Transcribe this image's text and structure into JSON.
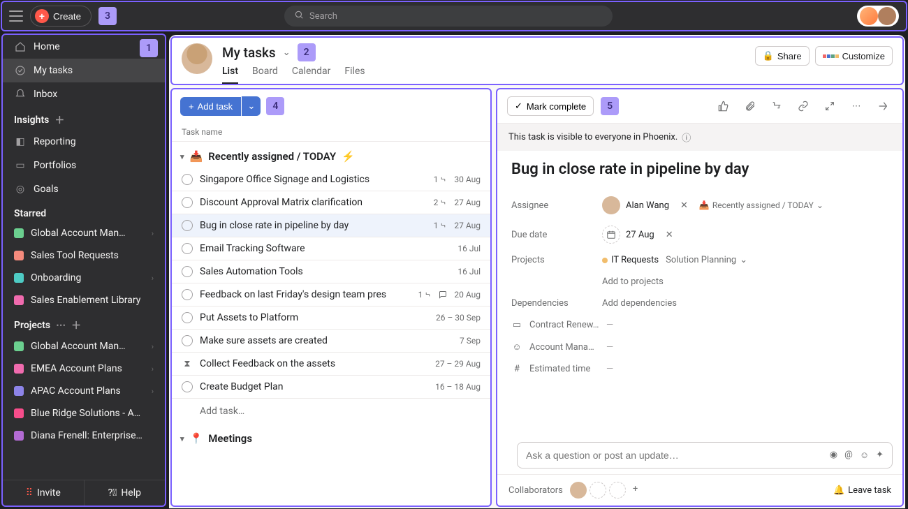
{
  "topbar": {
    "create_label": "Create",
    "search_placeholder": "Search"
  },
  "tags": {
    "t1": "1",
    "t2": "2",
    "t3": "3",
    "t4": "4",
    "t5": "5"
  },
  "sidebar": {
    "nav": [
      {
        "label": "Home"
      },
      {
        "label": "My tasks"
      },
      {
        "label": "Inbox"
      }
    ],
    "insights_header": "Insights",
    "insights": [
      {
        "label": "Reporting"
      },
      {
        "label": "Portfolios"
      },
      {
        "label": "Goals"
      }
    ],
    "starred_header": "Starred",
    "starred": [
      {
        "label": "Global Account Man…",
        "color": "#6bcf8f",
        "chev": true
      },
      {
        "label": "Sales Tool Requests",
        "color": "#f48a7c"
      },
      {
        "label": "Onboarding",
        "color": "#4ecbc4",
        "chev": true
      },
      {
        "label": "Sales Enablement Library",
        "color": "#f06bae"
      }
    ],
    "projects_header": "Projects",
    "projects": [
      {
        "label": "Global Account Man…",
        "color": "#6bcf8f",
        "chev": true
      },
      {
        "label": "EMEA Account Plans",
        "color": "#f06bae",
        "chev": true
      },
      {
        "label": "APAC Account Plans",
        "color": "#8d84e8",
        "chev": true
      },
      {
        "label": "Blue Ridge Solutions - A…",
        "color": "#f64d8b"
      },
      {
        "label": "Diana Frenell: Enterprise…",
        "color": "#b36bd4"
      }
    ],
    "invite_label": "Invite",
    "help_label": "Help"
  },
  "header": {
    "title": "My tasks",
    "tabs": [
      {
        "label": "List"
      },
      {
        "label": "Board"
      },
      {
        "label": "Calendar"
      },
      {
        "label": "Files"
      }
    ],
    "share_label": "Share",
    "customize_label": "Customize"
  },
  "tasklist": {
    "add_task": "Add task",
    "col_header": "Task name",
    "section1": "Recently assigned / TODAY",
    "tasks": [
      {
        "name": "Singapore Office Signage and Logistics",
        "sub": "1",
        "date": "30 Aug"
      },
      {
        "name": "Discount Approval Matrix clarification",
        "sub": "2",
        "date": "27 Aug"
      },
      {
        "name": "Bug in close rate in pipeline by day",
        "sub": "1",
        "date": "27 Aug",
        "selected": true
      },
      {
        "name": "Email Tracking Software",
        "date": "16 Jul"
      },
      {
        "name": "Sales Automation Tools",
        "date": "16 Jul"
      },
      {
        "name": "Feedback on last Friday's design team pres",
        "sub": "1",
        "comment": true,
        "date": "20 Aug"
      },
      {
        "name": "Put Assets to Platform",
        "date": "26 – 30 Sep"
      },
      {
        "name": "Make sure assets are created",
        "date": "7 Sep"
      },
      {
        "name": "Collect Feedback on the assets",
        "date": "27 – 29 Aug",
        "hourglass": true
      },
      {
        "name": "Create Budget Plan",
        "date": "16 – 18 Aug"
      }
    ],
    "add_task_row": "Add task…",
    "section2": "Meetings"
  },
  "detail": {
    "mark_complete": "Mark complete",
    "visibility": "This task is visible to everyone in Phoenix.",
    "title": "Bug in close rate in pipeline by day",
    "assignee_label": "Assignee",
    "assignee_name": "Alan Wang",
    "assignee_section": "Recently assigned / TODAY",
    "due_label": "Due date",
    "due_value": "27 Aug",
    "projects_label": "Projects",
    "project1": "IT Requests",
    "project2": "Solution Planning",
    "add_projects": "Add to projects",
    "dependencies_label": "Dependencies",
    "add_dependencies": "Add dependencies",
    "cf1_label": "Contract Renew…",
    "cf2_label": "Account Manager",
    "cf3_label": "Estimated time",
    "dash": "—",
    "comment_placeholder": "Ask a question or post an update…",
    "collaborators_label": "Collaborators",
    "leave_task": "Leave task"
  }
}
